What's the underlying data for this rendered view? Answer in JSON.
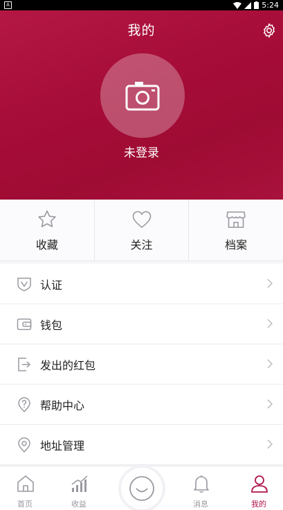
{
  "status_bar": {
    "time": "5:24"
  },
  "header": {
    "title": "我的",
    "login_text": "未登录"
  },
  "quick_actions": [
    {
      "label": "收藏",
      "icon": "star-icon"
    },
    {
      "label": "关注",
      "icon": "heart-icon"
    },
    {
      "label": "档案",
      "icon": "shop-icon"
    }
  ],
  "menu": [
    {
      "label": "认证",
      "icon": "verify-shield-icon"
    },
    {
      "label": "钱包",
      "icon": "wallet-icon"
    },
    {
      "label": "发出的红包",
      "icon": "red-packet-out-icon"
    },
    {
      "label": "帮助中心",
      "icon": "help-icon"
    },
    {
      "label": "地址管理",
      "icon": "location-icon"
    }
  ],
  "tabbar": [
    {
      "label": "首页",
      "icon": "home-icon"
    },
    {
      "label": "收益",
      "icon": "earnings-chart-icon"
    },
    {
      "label": "",
      "icon": "chat-bubble-icon"
    },
    {
      "label": "消息",
      "icon": "bell-icon"
    },
    {
      "label": "我的",
      "icon": "profile-icon"
    }
  ],
  "colors": {
    "brand": "#a70d39",
    "active_tab": "#b0124a",
    "icon_gray": "#9a98a0"
  }
}
